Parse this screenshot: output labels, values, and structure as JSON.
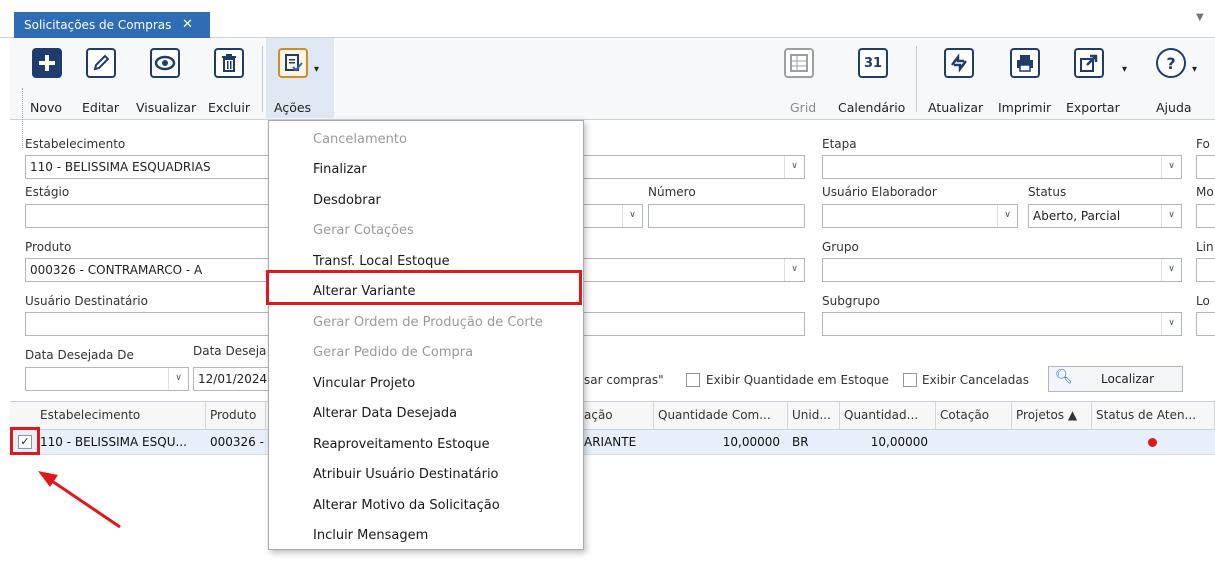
{
  "tab": {
    "title": "Solicitações de Compras",
    "close": "✕",
    "menu": "▼"
  },
  "toolbar": {
    "novo": "Novo",
    "editar": "Editar",
    "visualizar": "Visualizar",
    "excluir": "Excluir",
    "acoes": "Ações",
    "grid": "Grid",
    "calendario": "Calendário",
    "calendario_day": "31",
    "atualizar": "Atualizar",
    "imprimir": "Imprimir",
    "exportar": "Exportar",
    "ajuda": "Ajuda"
  },
  "filters": {
    "estabelecimento_label": "Estabelecimento",
    "estabelecimento_value": "110 - BELISSIMA ESQUADRIAS",
    "estagio_label": "Estágio",
    "produto_label": "Produto",
    "produto_value": "000326 - CONTRAMARCO - A",
    "usuario_destinatario_label": "Usuário Destinatário",
    "data_desejada_de_label": "Data Desejada De",
    "data_desejada_ate_label": "Data Deseja",
    "data_desejada_ate_value": "12/01/2024",
    "etapa_label": "Etapa",
    "fo_label": "Fo",
    "numero_label": "Número",
    "usuario_elaborador_label": "Usuário Elaborador",
    "status_label": "Status",
    "status_value": "Aberto, Parcial",
    "mo_label": "Mo",
    "grupo_label": "Grupo",
    "lin_label": "Lin",
    "subgrupo_label": "Subgrupo",
    "lo_label": "Lo",
    "usar_compras_text": "sar compras\"",
    "exibir_qtd_estoque": "Exibir Quantidade em Estoque",
    "exibir_canceladas": "Exibir Canceladas",
    "localizar": "Localizar"
  },
  "grid": {
    "columns": [
      "Estabelecimento",
      "Produto",
      "ação",
      "Quantidade Com...",
      "Unid...",
      "Quantidad...",
      "Cotação",
      "Projetos ▲",
      "Status de Aten..."
    ],
    "row": {
      "checked": "✓",
      "estabelecimento": "110 - BELISSIMA ESQU...",
      "produto": "000326 - C",
      "acao": "ARIANTE",
      "quantidade_com": "10,00000",
      "unidade": "BR",
      "quantidade": "10,00000",
      "status_color": "#e0181b"
    }
  },
  "menu": {
    "items": [
      {
        "label": "Cancelamento",
        "enabled": false
      },
      {
        "label": "Finalizar",
        "enabled": true
      },
      {
        "label": "Desdobrar",
        "enabled": true
      },
      {
        "label": "Gerar Cotações",
        "enabled": false
      },
      {
        "label": "Transf. Local Estoque",
        "enabled": true
      },
      {
        "label": "Alterar Variante",
        "enabled": true
      },
      {
        "label": "Gerar Ordem de Produção de Corte",
        "enabled": false
      },
      {
        "label": "Gerar Pedido de Compra",
        "enabled": false
      },
      {
        "label": "Vincular Projeto",
        "enabled": true
      },
      {
        "label": "Alterar Data Desejada",
        "enabled": true
      },
      {
        "label": "Reaproveitamento Estoque",
        "enabled": true
      },
      {
        "label": "Atribuir Usuário Destinatário",
        "enabled": true
      },
      {
        "label": "Alterar Motivo da Solicitação",
        "enabled": true
      },
      {
        "label": "Incluir Mensagem",
        "enabled": true
      }
    ]
  },
  "colors": {
    "accent": "#2e6db5",
    "highlight": "#e0181b",
    "row_selected": "#e6effa"
  }
}
